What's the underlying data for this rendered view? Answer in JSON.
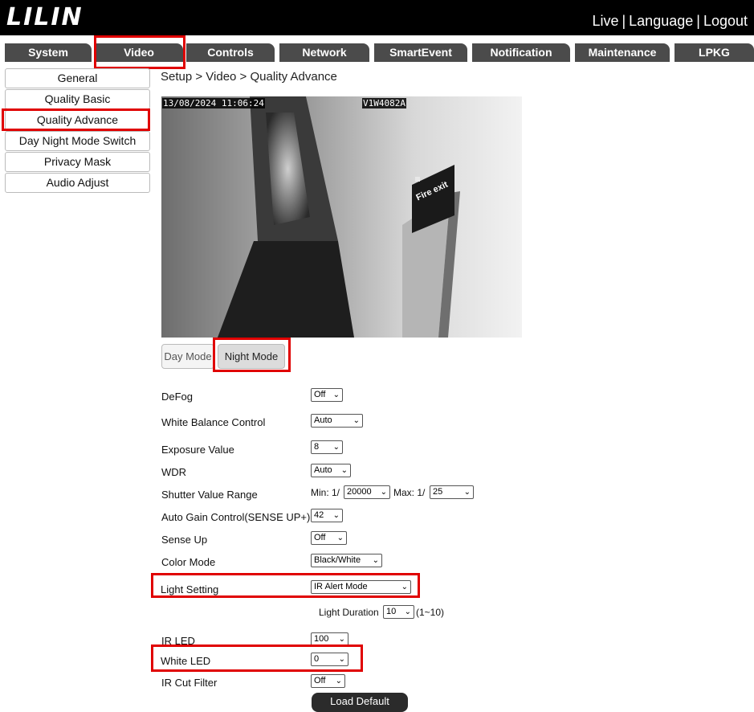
{
  "header": {
    "logo": "LILIN",
    "links": [
      "Live",
      "Language",
      "Logout"
    ],
    "separator": "|"
  },
  "nav_tabs": [
    "System",
    "Video",
    "Controls",
    "Network",
    "SmartEvent",
    "Notification",
    "Maintenance",
    "LPKG"
  ],
  "selected_tab": "Video",
  "sidebar": {
    "items": [
      "General",
      "Quality Basic",
      "Quality Advance",
      "Day Night Mode Switch",
      "Privacy Mask",
      "Audio Adjust"
    ],
    "selected": "Quality Advance"
  },
  "breadcrumb": "Setup > Video > Quality Advance",
  "video": {
    "timestamp": "13/08/2024 11:06:24",
    "camera_id": "V1W4082A",
    "sign_text": "Fire exit"
  },
  "mode_buttons": {
    "day": "Day Mode",
    "night": "Night Mode",
    "selected": "Night Mode"
  },
  "settings": {
    "defog": {
      "label": "DeFog",
      "value": "Off"
    },
    "white_balance": {
      "label": "White Balance Control",
      "value": "Auto"
    },
    "exposure": {
      "label": "Exposure Value",
      "value": "8"
    },
    "wdr": {
      "label": "WDR",
      "value": "Auto"
    },
    "shutter": {
      "label": "Shutter Value Range",
      "min_prefix": "Min: 1/",
      "min_value": "20000",
      "max_prefix": "Max: 1/",
      "max_value": "25"
    },
    "agc": {
      "label": "Auto Gain Control(SENSE UP+)",
      "value": "42"
    },
    "sense_up": {
      "label": "Sense Up",
      "value": "Off"
    },
    "color_mode": {
      "label": "Color Mode",
      "value": "Black/White"
    },
    "light_setting": {
      "label": "Light Setting",
      "value": "IR Alert Mode"
    },
    "light_duration": {
      "label": "Light Duration",
      "value": "10",
      "range": "(1~10)"
    },
    "ir_led": {
      "label": "IR LED",
      "value": "100"
    },
    "white_led": {
      "label": "White LED",
      "value": "0"
    },
    "ir_cut": {
      "label": "IR Cut Filter",
      "value": "Off"
    }
  },
  "load_default": "Load Default",
  "colors": {
    "topbar": "#000000",
    "tab": "#4b4b4b",
    "highlight": "#e00000"
  }
}
